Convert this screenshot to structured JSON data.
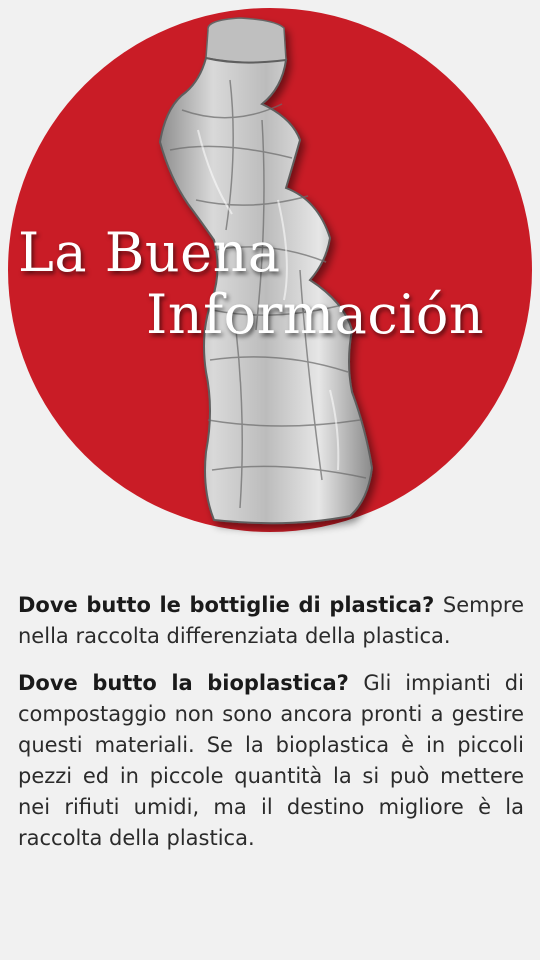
{
  "colors": {
    "background": "#f1f1f1",
    "circle": "#c91c26",
    "title": "#ffffff",
    "text": "#2b2b2b"
  },
  "hero": {
    "image": "crushed-plastic-bottle",
    "title_line_1": "La Buena",
    "title_line_2": "Información"
  },
  "faq": [
    {
      "question": "Dove butto le bottiglie di plastica?",
      "answer": "Sempre nella raccolta differenziata della plastica."
    },
    {
      "question": "Dove butto la bioplastica?",
      "answer": "Gli impianti di compostaggio non sono ancora pronti a gestire questi materiali. Se la bioplastica è in piccoli pezzi ed in piccole quantità la si può mettere nei rifiuti umidi, ma il destino migliore è la raccolta della plastica."
    }
  ]
}
